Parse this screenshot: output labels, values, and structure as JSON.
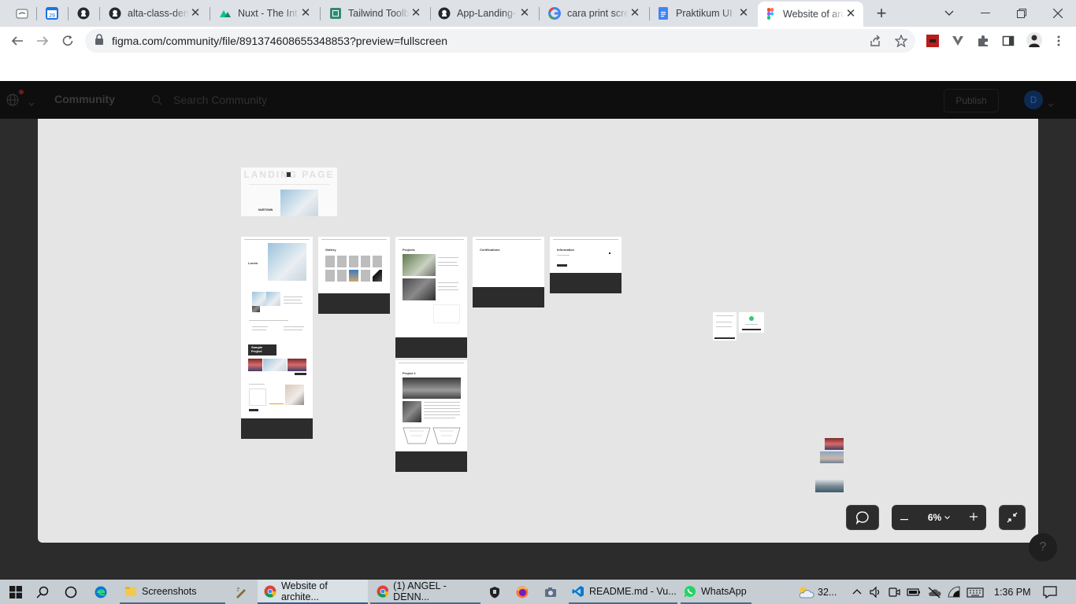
{
  "browser": {
    "tabs": [
      {
        "label": "",
        "icon": "toolbox-icon"
      },
      {
        "label": "",
        "icon": "calendar-icon",
        "badge": "29"
      },
      {
        "label": "",
        "icon": "github-icon"
      },
      {
        "label": "alta-class-dem",
        "icon": "github-icon"
      },
      {
        "label": "Nuxt - The Int",
        "icon": "nuxt-icon"
      },
      {
        "label": "Tailwind Toolb",
        "icon": "tailwind-toolbox-icon"
      },
      {
        "label": "App-Landing-",
        "icon": "github-icon"
      },
      {
        "label": "cara print scre",
        "icon": "google-icon"
      },
      {
        "label": "Praktikum UI",
        "icon": "google-docs-icon"
      },
      {
        "label": "Website of arc",
        "icon": "figma-icon",
        "active": true
      }
    ],
    "url": "figma.com/community/file/891374608655348853?preview=fullscreen"
  },
  "figma": {
    "header_title": "Community",
    "search_placeholder": "Search Community",
    "publish_label": "Publish",
    "avatar_initial": "D",
    "zoom_level": "6%",
    "help_label": "?"
  },
  "canvas": {
    "cover_title": "LANDING PAGE",
    "cover_brand": "NURTOWN",
    "frame_titles": {
      "home": "Lorem",
      "gallery": "Gallery",
      "projects": "Projects",
      "certifications": "Certifications",
      "information": "Information",
      "project_detail": "Project 1",
      "sample_project": "Sample Project"
    }
  },
  "taskbar": {
    "items": [
      {
        "label": "Screenshots",
        "icon": "folder-icon"
      },
      {
        "label": "Website of archite...",
        "icon": "chrome-icon",
        "active": true
      },
      {
        "label": "(1) ANGEL - DENN...",
        "icon": "chrome-icon"
      },
      {
        "label": "README.md - Vu...",
        "icon": "vscode-icon"
      },
      {
        "label": "WhatsApp",
        "icon": "whatsapp-icon"
      }
    ],
    "weather": "32...",
    "clock": "1:36 PM"
  },
  "colors": {
    "tab_strip": "#dee1e6",
    "figma_header": "#0e0e0e",
    "canvas": "#e5e5e5",
    "taskbar": "#c6ced4",
    "figma_dark": "#2c2c2c"
  }
}
